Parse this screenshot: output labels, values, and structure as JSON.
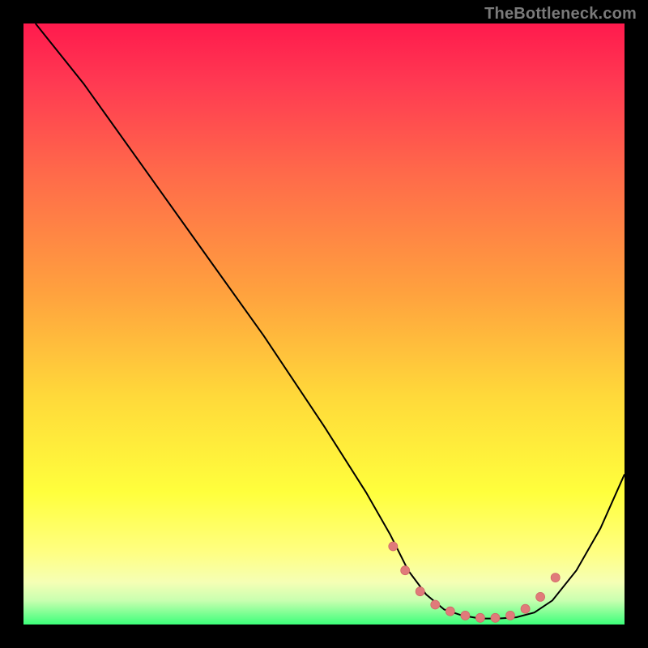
{
  "attribution": "TheBottleneck.com",
  "colors": {
    "page_bg": "#000000",
    "grad_top": "#ff1a4d",
    "grad_bottom": "#3cff7a",
    "curve": "#000000",
    "dot": "#e07a7a"
  },
  "chart_data": {
    "type": "line",
    "title": "",
    "xlabel": "",
    "ylabel": "",
    "xlim": [
      0,
      100
    ],
    "ylim": [
      0,
      100
    ],
    "grid": false,
    "series": [
      {
        "name": "curve",
        "x": [
          2,
          10,
          20,
          30,
          40,
          50,
          57,
          61,
          64,
          67,
          70,
          73,
          76,
          79,
          82,
          85,
          88,
          92,
          96,
          100
        ],
        "y": [
          100,
          90,
          76,
          62,
          48,
          33,
          22,
          15,
          9,
          5,
          2.5,
          1.5,
          1,
          1,
          1.2,
          2,
          4,
          9,
          16,
          25
        ]
      }
    ],
    "markers": {
      "name": "highlight-dots",
      "x": [
        61.5,
        63.5,
        66,
        68.5,
        71,
        73.5,
        76,
        78.5,
        81,
        83.5,
        86,
        88.5
      ],
      "y": [
        13,
        9,
        5.5,
        3.3,
        2.2,
        1.5,
        1.1,
        1.1,
        1.5,
        2.6,
        4.6,
        7.8
      ]
    }
  }
}
